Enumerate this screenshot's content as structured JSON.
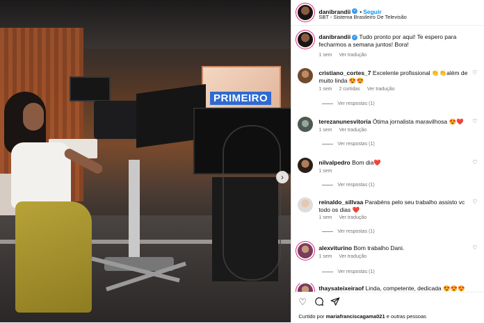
{
  "post": {
    "username": "danibrandii",
    "follow_label": "Seguir",
    "dot": "•",
    "subtitle": "SBT - Sistema Brasileiro De Televisão",
    "verified_mark": "✓",
    "caption_user": "danibrandii",
    "caption_text": "Tudo pronto por aqui! Te espero para fecharmos a semana juntos! Bora!",
    "caption_time": "1 sem",
    "caption_translate": "Ver tradução",
    "photo_screen_text": "PRIMEIRO"
  },
  "comments": [
    {
      "user": "cristiano_cortes_7",
      "text": "Excelente profissional 👏👏além de muito linda 😍😍",
      "time": "1 sem",
      "likes": "2 curtidas",
      "translate": "Ver tradução",
      "replies": "Ver respostas (1)"
    },
    {
      "user": "terezanunesvitoria",
      "text": "Ótima jornalista maravilhosa 😍❤️",
      "time": "1 sem",
      "likes": "",
      "translate": "Ver tradução",
      "replies": "Ver respostas (1)"
    },
    {
      "user": "nilvalpedro",
      "text": "Bom dia❤️",
      "time": "1 sem",
      "likes": "",
      "translate": "",
      "replies": "Ver respostas (1)"
    },
    {
      "user": "reinaldo_sillvaa",
      "text": "Parabéns pelo seu trabalho assisto vc todo os dias ❤️",
      "time": "1 sem",
      "likes": "",
      "translate": "Ver tradução",
      "replies": "Ver respostas (1)"
    },
    {
      "user": "alexviturino",
      "text": "Bom trabalho Dani.",
      "time": "1 sem",
      "likes": "",
      "translate": "Ver tradução",
      "replies": "Ver respostas (1)"
    },
    {
      "user": "thaysateixeiraof",
      "text": "Linda, competente, dedicada 😍😍😍",
      "time": "",
      "likes": "",
      "translate": "",
      "replies": ""
    }
  ],
  "actions": {
    "like_icon": "heart-outline",
    "comment_icon": "speech-bubble",
    "share_icon": "paper-plane"
  },
  "likes_line": {
    "prefix": "Curtido por",
    "user": "mariafranciscagama021",
    "suffix": "e outras pessoas"
  },
  "colors": {
    "link_blue": "#0095f6",
    "verified_blue": "#3897f0",
    "story_ring": "#d62976"
  }
}
